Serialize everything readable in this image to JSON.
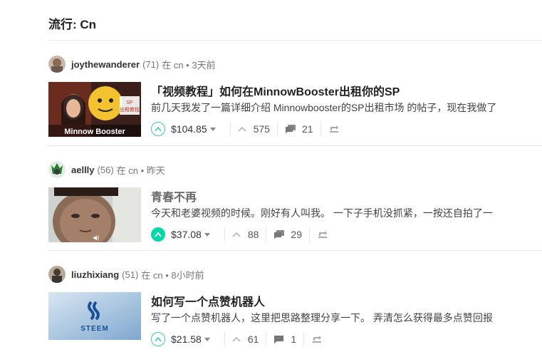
{
  "page": {
    "title": "流行: Cn"
  },
  "posts": [
    {
      "author": "joythewanderer",
      "reputation": "(71)",
      "meta": "在 cn • 3天前",
      "title": "「视频教程」如何在MinnowBooster出租你的SP",
      "excerpt": "前几天我发了一篇详细介绍 Minnowbooster的SP出租市场 的帖子，现在我做了",
      "payout": "$104.85",
      "votes": "575",
      "comments": "21",
      "thumb_text": {
        "brand": "Minnow Booster",
        "badge_line1": "SP",
        "badge_line2": "出租教程"
      },
      "upvoted": false
    },
    {
      "author": "aellly",
      "reputation": "(56)",
      "meta": "在 cn • 昨天",
      "title": "青春不再",
      "excerpt": "今天和老婆视频的时候。刚好有人叫我。 一下子手机没抓紧，一按还自拍了一",
      "payout": "$37.08",
      "votes": "88",
      "comments": "29",
      "upvoted": true
    },
    {
      "author": "liuzhixiang",
      "reputation": "(51)",
      "meta": "在 cn • 8小时前",
      "title": "如何写一个点赞机器人",
      "excerpt": "写了一个点赞机器人，这里把思路整理分享一下。 弄清怎么获得最多点赞回报",
      "payout": "$21.58",
      "votes": "61",
      "comments": "1",
      "thumb_text": {
        "brand": "STEEM"
      },
      "upvoted": false
    }
  ],
  "colors": {
    "accent": "#06d6a9",
    "steem_blue": "#1a5099"
  }
}
